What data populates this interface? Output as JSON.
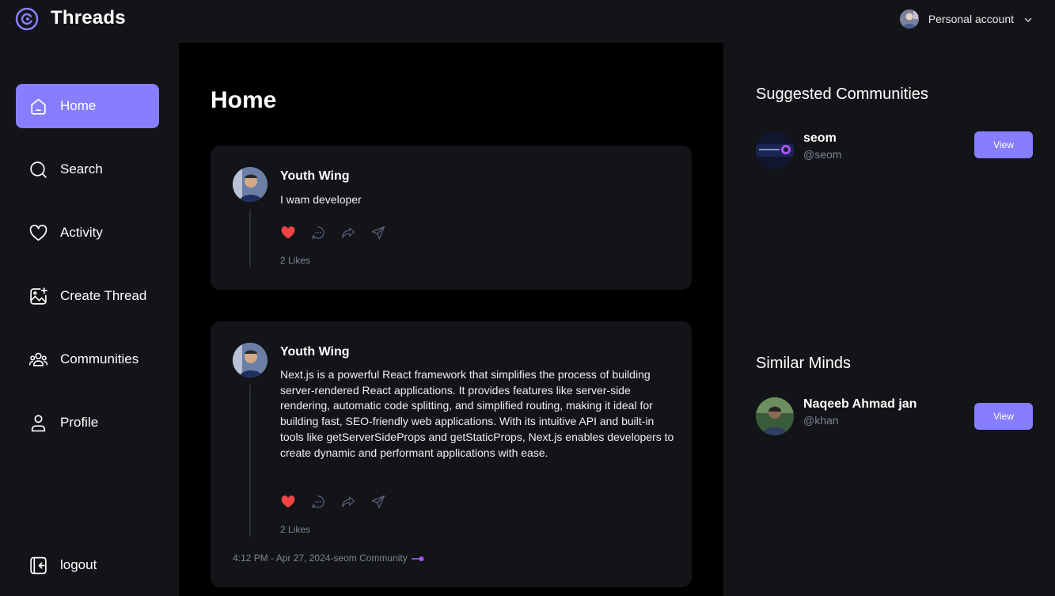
{
  "app": {
    "brand": "Threads"
  },
  "account": {
    "label": "Personal account"
  },
  "sidebar": {
    "items": [
      {
        "label": "Home",
        "icon": "home-icon",
        "active": true
      },
      {
        "label": "Search",
        "icon": "search-icon"
      },
      {
        "label": "Activity",
        "icon": "heart-icon"
      },
      {
        "label": "Create Thread",
        "icon": "image-plus-icon"
      },
      {
        "label": "Communities",
        "icon": "users-icon"
      },
      {
        "label": "Profile",
        "icon": "user-icon"
      }
    ],
    "logout": {
      "label": "logout",
      "icon": "logout-icon"
    }
  },
  "main": {
    "title": "Home",
    "threads": [
      {
        "author": "Youth Wing",
        "content": "I wam developer",
        "likes": "2 Likes"
      },
      {
        "author": "Youth Wing",
        "content": "Next.js is a powerful React framework that simplifies the process of building server-rendered React applications. It provides features like server-side rendering, automatic code splitting, and simplified routing, making it ideal for building fast, SEO-friendly web applications. With its intuitive API and built-in tools like getServerSideProps and getStaticProps, Next.js enables developers to create dynamic and performant applications with ease.",
        "likes": "2 Likes",
        "meta": "4:12 PM - Apr 27, 2024-seom Community"
      }
    ]
  },
  "right": {
    "suggested_title": "Suggested Communities",
    "communities": [
      {
        "name": "seom",
        "handle": "@seom",
        "button": "View"
      }
    ],
    "similar_title": "Similar Minds",
    "users": [
      {
        "name": "Naqeeb Ahmad jan",
        "handle": "@khan",
        "button": "View"
      }
    ]
  },
  "colors": {
    "accent": "#877eff",
    "bg_dark": "#121417",
    "main_bg": "#000000",
    "like_red": "#ef4444"
  }
}
